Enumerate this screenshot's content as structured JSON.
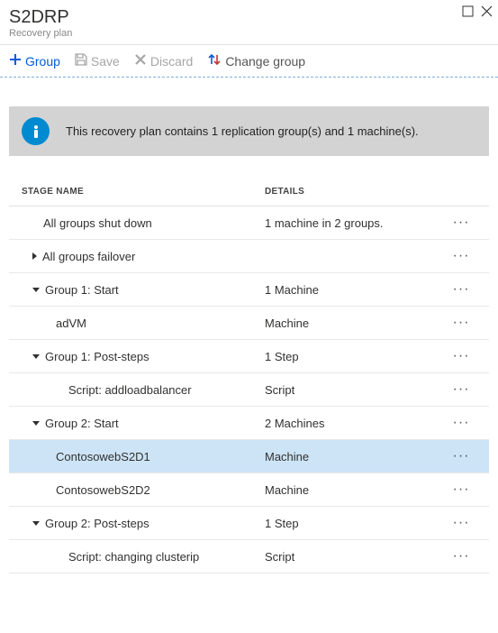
{
  "header": {
    "title": "S2DRP",
    "subtitle": "Recovery plan"
  },
  "toolbar": {
    "group": "Group",
    "save": "Save",
    "discard": "Discard",
    "change_group": "Change group"
  },
  "info": {
    "message": "This recovery plan contains 1 replication group(s) and 1 machine(s)."
  },
  "table": {
    "headers": {
      "stage": "STAGE NAME",
      "details": "DETAILS"
    },
    "rows": [
      {
        "stage": "All groups shut down",
        "details": "1 machine in 2 groups.",
        "caret": null,
        "indent": "1c"
      },
      {
        "stage": "All groups failover",
        "details": "",
        "caret": "right",
        "indent": "1"
      },
      {
        "stage": "Group 1: Start",
        "details": "1 Machine",
        "caret": "down",
        "indent": "1"
      },
      {
        "stage": "adVM",
        "details": "Machine",
        "caret": null,
        "indent": "2c"
      },
      {
        "stage": "Group 1: Post-steps",
        "details": "1 Step",
        "caret": "down",
        "indent": "1"
      },
      {
        "stage": "Script: addloadbalancer",
        "details": "Script",
        "caret": null,
        "indent": "3c"
      },
      {
        "stage": "Group 2: Start",
        "details": "2 Machines",
        "caret": "down",
        "indent": "1"
      },
      {
        "stage": "ContosowebS2D1",
        "details": "Machine",
        "caret": null,
        "indent": "2c",
        "selected": true
      },
      {
        "stage": "ContosowebS2D2",
        "details": "Machine",
        "caret": null,
        "indent": "2c"
      },
      {
        "stage": "Group 2: Post-steps",
        "details": "1 Step",
        "caret": "down",
        "indent": "1"
      },
      {
        "stage": "Script: changing clusterip",
        "details": "Script",
        "caret": null,
        "indent": "3c"
      }
    ]
  }
}
